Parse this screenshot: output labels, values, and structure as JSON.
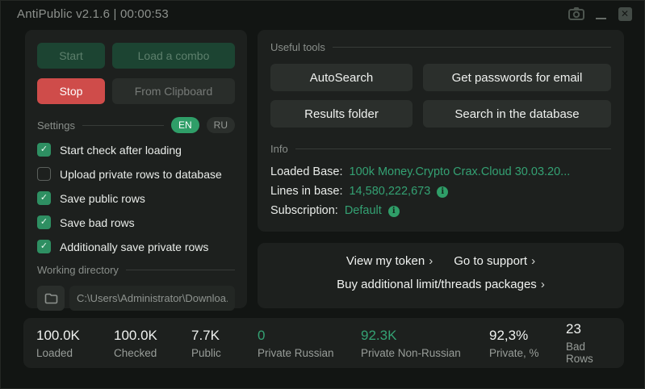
{
  "window": {
    "title": "AntiPublic v2.1.6 | 00:00:53"
  },
  "left_panel": {
    "buttons": {
      "start": "Start",
      "load_combo": "Load a combo",
      "stop": "Stop",
      "from_clipboard": "From Clipboard"
    },
    "settings": {
      "label": "Settings",
      "languages": [
        {
          "label": "EN",
          "active": true
        },
        {
          "label": "RU",
          "active": false
        }
      ]
    },
    "checkboxes": [
      {
        "label": "Start check after loading",
        "checked": true
      },
      {
        "label": "Upload private rows to database",
        "checked": false
      },
      {
        "label": "Save public rows",
        "checked": true
      },
      {
        "label": "Save bad rows",
        "checked": true
      },
      {
        "label": "Additionally save private rows",
        "checked": true
      }
    ],
    "working_directory": {
      "label": "Working directory",
      "path": "C:\\Users\\Administrator\\Downloa..."
    }
  },
  "tools": {
    "label": "Useful tools",
    "buttons": [
      "AutoSearch",
      "Get passwords for email",
      "Results folder",
      "Search in the database"
    ]
  },
  "info": {
    "label": "Info",
    "rows": [
      {
        "label": "Loaded Base:",
        "value": "100k Money.Crypto Crax.Cloud 30.03.20..."
      },
      {
        "label": "Lines in base:",
        "value": "14,580,222,673"
      },
      {
        "label": "Subscription:",
        "value": "Default"
      }
    ],
    "info_icon_glyph": "i"
  },
  "links": {
    "view_token": "View my token",
    "support": "Go to support",
    "buy": "Buy additional limit/threads packages",
    "chevron": "›"
  },
  "stats": [
    {
      "value": "100.0K",
      "label": "Loaded"
    },
    {
      "value": "100.0K",
      "label": "Checked"
    },
    {
      "value": "7.7K",
      "label": "Public"
    },
    {
      "value": "0",
      "label": "Private Russian"
    },
    {
      "value": "92.3K",
      "label": "Private Non-Russian"
    },
    {
      "value": "92,3%",
      "label": "Private, %"
    },
    {
      "value": "23",
      "label": "Bad Rows"
    }
  ],
  "glyphs": {
    "check": "✓",
    "minimize": "_",
    "close": "✕"
  },
  "colors": {
    "accent_green": "#2f9e68",
    "text_green": "#34a173",
    "stop_red": "#cf4c4a",
    "dark_green_button": "#1c4432",
    "card_bg": "#1d201e",
    "window_bg": "#121513"
  }
}
